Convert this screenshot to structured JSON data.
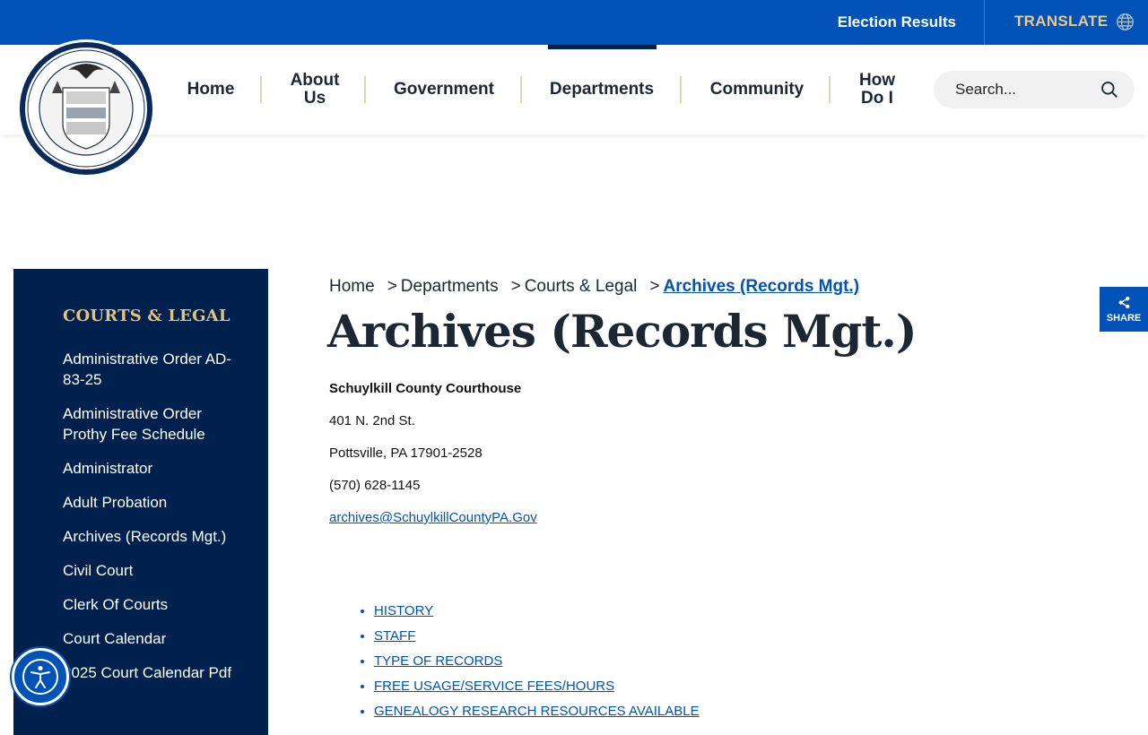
{
  "topbar": {
    "election_results": "Election Results",
    "translate": "TRANSLATE"
  },
  "header": {
    "nav": [
      {
        "label": "Home"
      },
      {
        "label": "About Us"
      },
      {
        "label": "Government"
      },
      {
        "label": "Departments"
      },
      {
        "label": "Community"
      },
      {
        "label": "How Do I"
      }
    ],
    "search": {
      "placeholder": "Search..."
    }
  },
  "sidebar": {
    "title": "COURTS & LEGAL",
    "items": [
      {
        "label": "Administrative Order AD-83-25"
      },
      {
        "label": "Administrative Order Prothy Fee Schedule"
      },
      {
        "label": "Administrator"
      },
      {
        "label": "Adult Probation"
      },
      {
        "label": "Archives (Records Mgt.)"
      },
      {
        "label": "Civil Court"
      },
      {
        "label": "Clerk Of Courts"
      },
      {
        "label": "Court Calendar"
      },
      {
        "label": "2025 Court Calendar Pdf"
      }
    ]
  },
  "breadcrumb": {
    "home": "Home",
    "departments": "Departments",
    "courts": "Courts & Legal",
    "current": "Archives (Records Mgt.)",
    "separator": ">"
  },
  "page": {
    "title": "Archives (Records Mgt.)",
    "address": {
      "name": "Schuylkill County Courthouse",
      "street": "401 N. 2nd St.",
      "city": "Pottsville, PA 17901-2528",
      "phone": "(570) 628-1145",
      "email": "archives@SchuylkillCountyPA.Gov"
    },
    "links": [
      {
        "label": "HISTORY"
      },
      {
        "label": "STAFF"
      },
      {
        "label": "TYPE OF RECORDS"
      },
      {
        "label": "FREE USAGE/SERVICE FEES/HOURS"
      },
      {
        "label": "GENEALOGY RESEARCH RESOURCES AVAILABLE"
      }
    ]
  },
  "share": {
    "label": "SHARE"
  },
  "colors": {
    "brand_blue": "#0052b7",
    "navy": "#00214d",
    "gold": "#e4c27a"
  }
}
